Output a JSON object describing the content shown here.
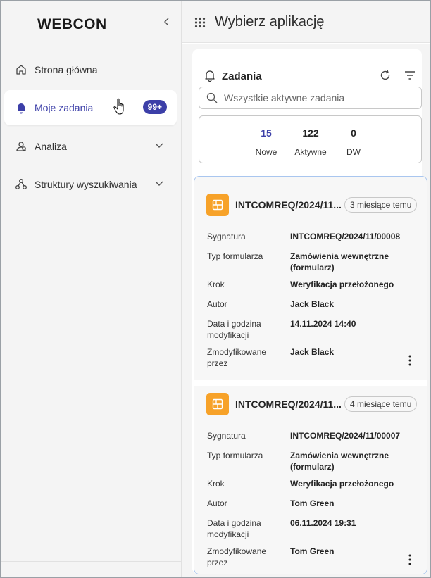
{
  "sidebar": {
    "logo": "WEBCON",
    "nav": [
      {
        "label": "Strona główna"
      },
      {
        "label": "Moje zadania",
        "badge": "99+"
      },
      {
        "label": "Analiza"
      },
      {
        "label": "Struktury wyszukiwania"
      }
    ]
  },
  "header": {
    "title": "Wybierz aplikację"
  },
  "tasks": {
    "title": "Zadania",
    "search_placeholder": "Wszystkie aktywne zadania",
    "stats": [
      {
        "value": "15",
        "label": "Nowe"
      },
      {
        "value": "122",
        "label": "Aktywne"
      },
      {
        "value": "0",
        "label": "DW"
      }
    ],
    "items": [
      {
        "title": "INTCOMREQ/2024/11...",
        "time": "3 miesiące temu",
        "fields": [
          {
            "k": "Sygnatura",
            "v": "INTCOMREQ/2024/11/00008"
          },
          {
            "k": "Typ formularza",
            "v": "Zamówienia wewnętrzne (formularz)"
          },
          {
            "k": "Krok",
            "v": "Weryfikacja przełożonego"
          },
          {
            "k": "Autor",
            "v": "Jack Black"
          },
          {
            "k": "Data i godzina modyfikacji",
            "v": "14.11.2024 14:40"
          },
          {
            "k": "Zmodyfikowane przez",
            "v": "Jack Black"
          }
        ]
      },
      {
        "title": "INTCOMREQ/2024/11...",
        "time": "4 miesiące temu",
        "fields": [
          {
            "k": "Sygnatura",
            "v": "INTCOMREQ/2024/11/00007"
          },
          {
            "k": "Typ formularza",
            "v": "Zamówienia wewnętrzne (formularz)"
          },
          {
            "k": "Krok",
            "v": "Weryfikacja przełożonego"
          },
          {
            "k": "Autor",
            "v": "Tom Green"
          },
          {
            "k": "Data i godzina modyfikacji",
            "v": "06.11.2024 19:31"
          },
          {
            "k": "Zmodyfikowane przez",
            "v": "Tom Green"
          }
        ]
      }
    ]
  },
  "colors": {
    "accent": "#3c3fa8",
    "app_icon": "#f7a229",
    "selected_border": "#a9c6ef"
  },
  "icons": [
    "home-icon",
    "bell-icon",
    "analysis-icon",
    "structure-icon",
    "chevron-left-icon",
    "chevron-down-icon",
    "app-grid-icon",
    "refresh-icon",
    "filter-icon",
    "search-icon",
    "app-form-icon",
    "more-vertical-icon",
    "hand-cursor-icon"
  ]
}
